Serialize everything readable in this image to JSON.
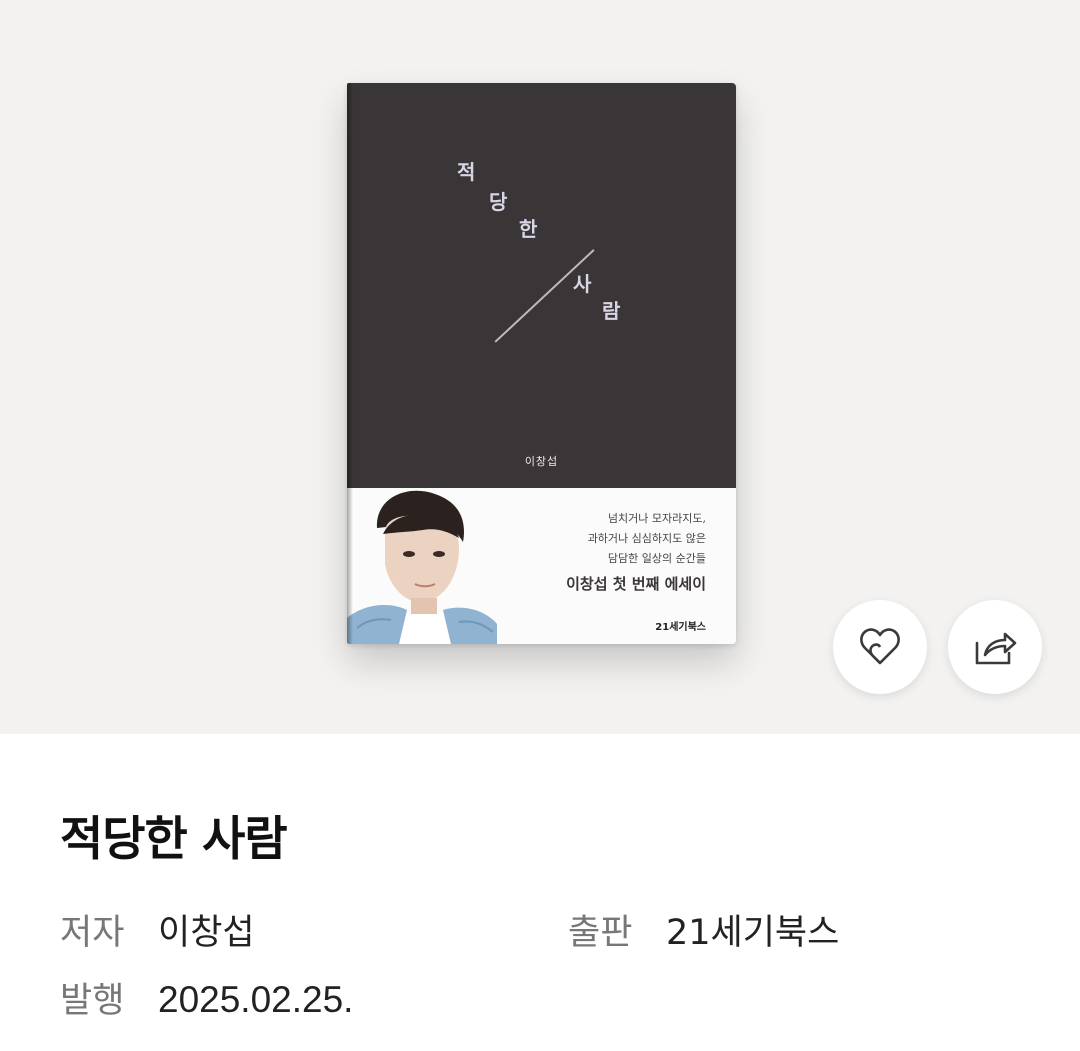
{
  "book": {
    "cover": {
      "title_chars": [
        "적",
        "당",
        "한",
        "사",
        "람"
      ],
      "author": "이창섭",
      "blurb_lines": [
        "넘치거나 모자라지도,",
        "과하거나 심심하지도 않은",
        "담담한 일상의 순간들"
      ],
      "series_label": "이창섭 첫 번째 에세이",
      "publisher_logo": "21세기북스",
      "background_color": "#3a3536"
    },
    "title": "적당한 사람",
    "author_label": "저자",
    "author": "이창섭",
    "publisher_label": "출판",
    "publisher": "21세기북스",
    "date_label": "발행",
    "date": "2025.02.25."
  },
  "actions": {
    "like_icon": "heart-icon",
    "share_icon": "share-icon"
  }
}
